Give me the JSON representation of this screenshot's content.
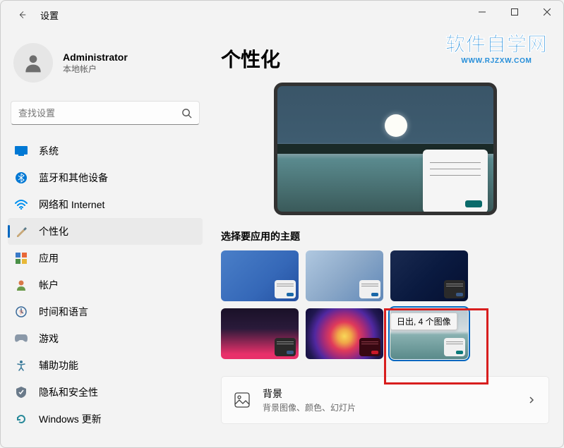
{
  "window": {
    "title": "设置"
  },
  "user": {
    "name": "Administrator",
    "type": "本地帐户"
  },
  "search": {
    "placeholder": "查找设置"
  },
  "nav": [
    {
      "label": "系统"
    },
    {
      "label": "蓝牙和其他设备"
    },
    {
      "label": "网络和 Internet"
    },
    {
      "label": "个性化"
    },
    {
      "label": "应用"
    },
    {
      "label": "帐户"
    },
    {
      "label": "时间和语言"
    },
    {
      "label": "游戏"
    },
    {
      "label": "辅助功能"
    },
    {
      "label": "隐私和安全性"
    },
    {
      "label": "Windows 更新"
    }
  ],
  "page": {
    "title": "个性化"
  },
  "themes": {
    "section_label": "选择要应用的主题",
    "tooltip": "日出, 4 个图像"
  },
  "background": {
    "title": "背景",
    "desc": "背景图像、颜色、幻灯片"
  },
  "watermark": {
    "cn": "软件自学网",
    "url": "WWW.RJZXW.COM"
  }
}
